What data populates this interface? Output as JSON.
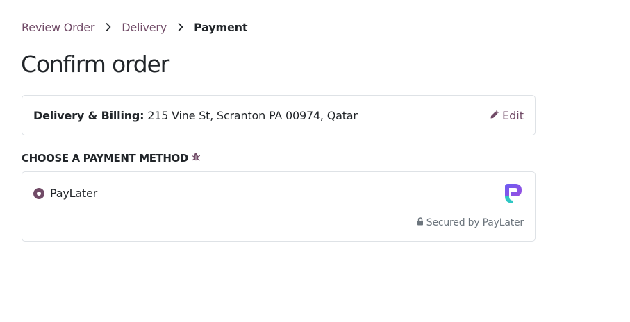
{
  "breadcrumb": {
    "items": [
      "Review Order",
      "Delivery"
    ],
    "current": "Payment"
  },
  "page": {
    "title": "Confirm order"
  },
  "address": {
    "label": "Delivery & Billing:",
    "value": "215 Vine St, Scranton PA 00974, Qatar",
    "edit_label": "Edit"
  },
  "payment": {
    "section_title": "CHOOSE A PAYMENT METHOD",
    "method_name": "PayLater",
    "secured_text": "Secured by PayLater",
    "selected": true
  },
  "colors": {
    "accent": "#714B67",
    "text": "#212529",
    "muted": "#6c757d",
    "border": "#dee2e6"
  },
  "icons": [
    "chevron-right-icon",
    "pencil-icon",
    "bug-icon",
    "lock-icon",
    "paylater-logo"
  ]
}
